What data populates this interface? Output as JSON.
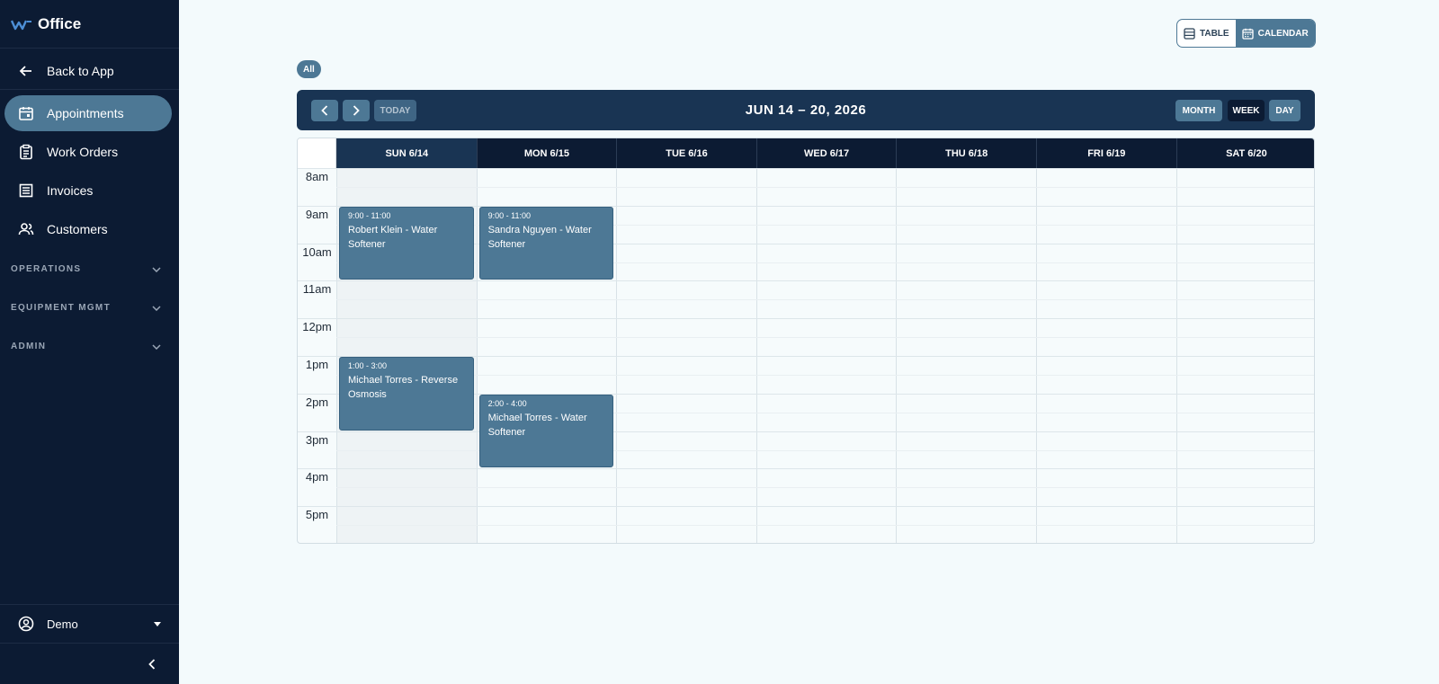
{
  "sidebar": {
    "brand": "Office",
    "back": "Back to App",
    "items": [
      {
        "label": "Appointments"
      },
      {
        "label": "Work Orders"
      },
      {
        "label": "Invoices"
      },
      {
        "label": "Customers"
      }
    ],
    "groups": [
      {
        "label": "OPERATIONS"
      },
      {
        "label": "EQUIPMENT MGMT"
      },
      {
        "label": "ADMIN"
      }
    ],
    "user": "Demo"
  },
  "view_toggle": {
    "table": "TABLE",
    "calendar": "CALENDAR",
    "selected": "CALENDAR"
  },
  "filter": {
    "label": "All"
  },
  "toolbar": {
    "title": "JUN 14 – 20, 2026",
    "today": "TODAY",
    "month": "MONTH",
    "week": "WEEK",
    "day": "DAY",
    "selected_view": "WEEK"
  },
  "calendar": {
    "days": [
      "SUN 6/14",
      "MON 6/15",
      "TUE 6/16",
      "WED 6/17",
      "THU 6/18",
      "FRI 6/19",
      "SAT 6/20"
    ],
    "today_index": 0,
    "hours": [
      "8am",
      "9am",
      "10am",
      "11am",
      "12pm",
      "1pm",
      "2pm",
      "3pm",
      "4pm",
      "5pm"
    ],
    "events": [
      {
        "time": "9:00 - 11:00",
        "title": "Robert Klein - Water Softener"
      },
      {
        "time": "9:00 - 11:00",
        "title": "Sandra Nguyen - Water Softener"
      },
      {
        "time": "1:00 - 3:00",
        "title": "Michael Torres - Reverse Osmosis"
      },
      {
        "time": "2:00 - 4:00",
        "title": "Michael Torres - Water Softener"
      }
    ]
  },
  "colors": {
    "sidebar": "#0c1b33",
    "accent": "#4d7895",
    "toolbar": "#193453",
    "background": "#f3fafc"
  }
}
